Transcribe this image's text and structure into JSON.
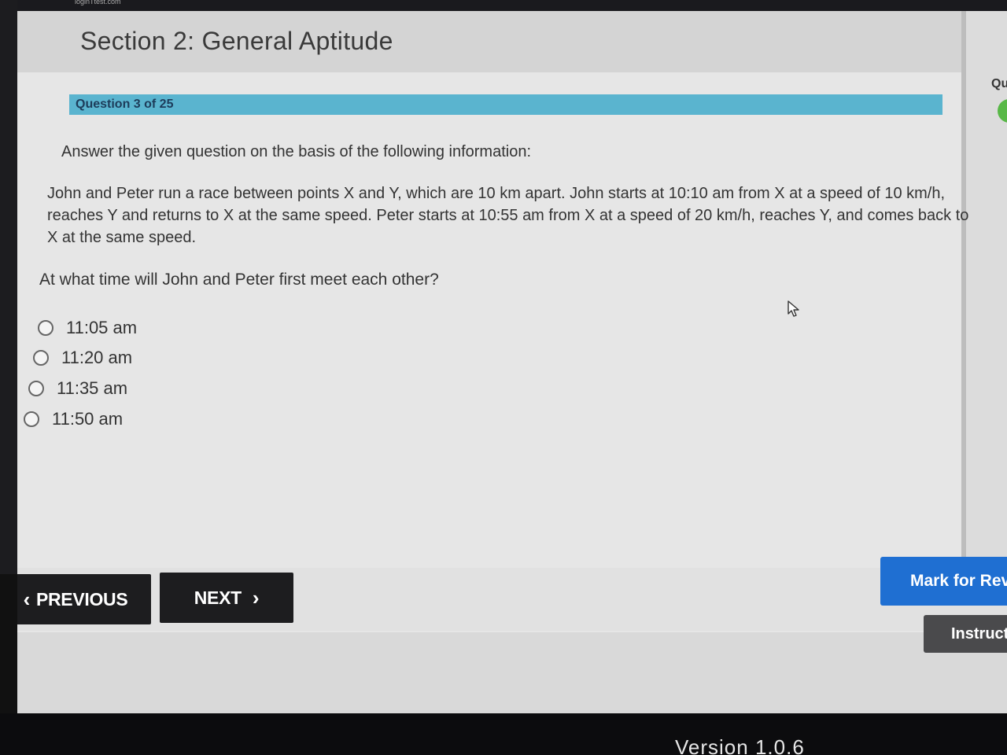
{
  "browser": {
    "url_fragment": "loginTtest.com"
  },
  "section": {
    "title": "Section 2: General Aptitude"
  },
  "side_panel": {
    "label": "Qu"
  },
  "question": {
    "counter": "Question 3 of 25",
    "intro": "Answer the given question on the basis of the following information:",
    "passage": "John and Peter run a race between points X and Y, which are 10 km apart. John starts at 10:10 am from X at a speed of 10 km/h, reaches Y and returns to X at the same speed. Peter starts at 10:55 am from X at a speed of 20 km/h, reaches Y, and comes back to X at the same speed.",
    "prompt": "At what time will John and Peter first meet each other?",
    "options": [
      {
        "label": "11:05 am"
      },
      {
        "label": "11:20 am"
      },
      {
        "label": "11:35 am"
      },
      {
        "label": "11:50 am"
      }
    ]
  },
  "nav": {
    "previous_label": "PREVIOUS",
    "next_label": "NEXT",
    "mark_label": "Mark for Revi",
    "instructions_label": "Instruct"
  },
  "footer": {
    "version": "Version 1.0.6"
  },
  "icons": {
    "prev": "chevron-left-icon",
    "next": "chevron-right-icon",
    "radio": "radio-unselected-icon",
    "cursor": "mouse-pointer-icon"
  },
  "colors": {
    "question_bar": "#5ab4cf",
    "mark_button": "#1f6fd2",
    "nav_button": "#1d1d1f",
    "status_dot": "#58b847"
  }
}
